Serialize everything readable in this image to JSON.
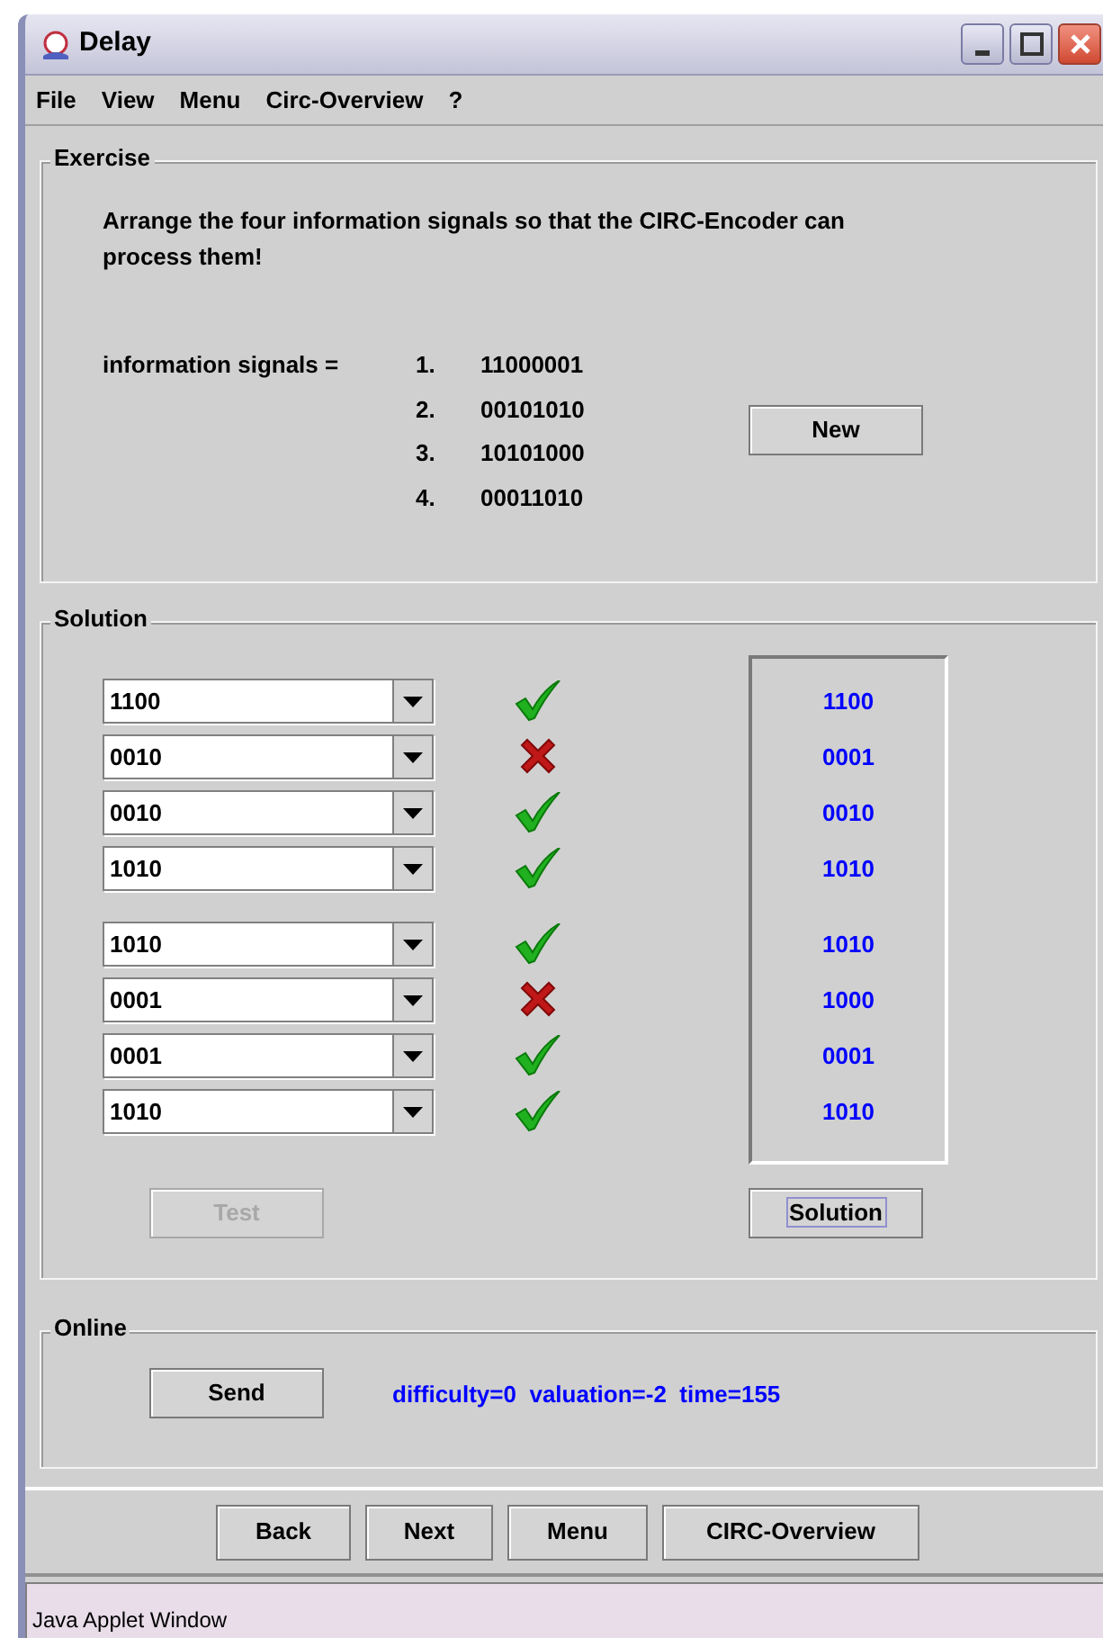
{
  "window": {
    "title": "Delay"
  },
  "menu": [
    "File",
    "View",
    "Menu",
    "Circ-Overview",
    "?"
  ],
  "exercise": {
    "title": "Exercise",
    "instruction": "Arrange the four information signals so that the CIRC-Encoder can process them!",
    "signals_label": "information signals =",
    "signals": [
      {
        "number": "1.",
        "value": "11000001"
      },
      {
        "number": "2.",
        "value": "00101010"
      },
      {
        "number": "3.",
        "value": "10101000"
      },
      {
        "number": "4.",
        "value": "00011010"
      }
    ],
    "new_button": "New"
  },
  "solution": {
    "title": "Solution",
    "blocks": [
      {
        "rows": [
          {
            "value": "1100",
            "correct": true,
            "solution": "1100"
          },
          {
            "value": "0010",
            "correct": false,
            "solution": "0001"
          },
          {
            "value": "0010",
            "correct": true,
            "solution": "0010"
          },
          {
            "value": "1010",
            "correct": true,
            "solution": "1010"
          }
        ]
      },
      {
        "rows": [
          {
            "value": "1010",
            "correct": true,
            "solution": "1010"
          },
          {
            "value": "0001",
            "correct": false,
            "solution": "1000"
          },
          {
            "value": "0001",
            "correct": true,
            "solution": "0001"
          },
          {
            "value": "1010",
            "correct": true,
            "solution": "1010"
          }
        ]
      }
    ],
    "test_button": {
      "label": "Test",
      "disabled": true
    },
    "solution_button": {
      "label": "Solution",
      "focused": true
    }
  },
  "online": {
    "title": "Online",
    "send_button": "Send",
    "status": "difficulty=0  valuation=-2  time=155"
  },
  "nav_buttons": [
    "Back",
    "Next",
    "Menu",
    "CIRC-Overview"
  ],
  "status_bar": "Java Applet Window"
}
